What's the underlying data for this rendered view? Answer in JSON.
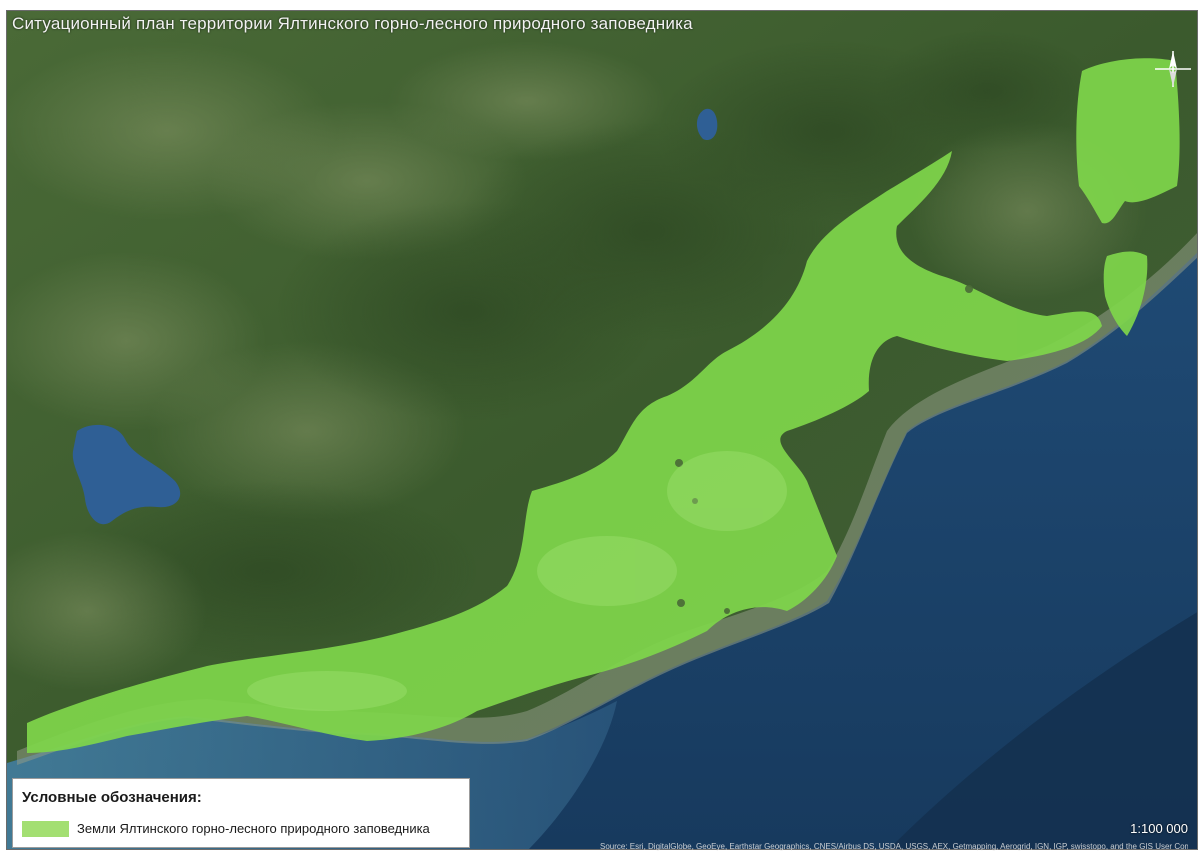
{
  "map": {
    "title": "Ситуационный план территории Ялтинского горно-лесного природного заповедника",
    "basemap": "satellite-imagery",
    "scale": "1:100 000",
    "credits": "Source: Esri, DigitalGlobe, GeoEye, Earthstar Geographics, CNES/Airbus DS, USDA, USGS, AEX, Getmapping, Aerogrid, IGN, IGP, swisstopo, and the GIS User Community"
  },
  "legend": {
    "title": "Условные обозначения:",
    "items": [
      {
        "label": "Земли Ялтинского горно-лесного природного заповедника",
        "color": "#a3df72"
      }
    ]
  },
  "colors": {
    "reserve_fill": "#7fd64b",
    "sea": "#1d3f66",
    "sea_shallow": "#3a6f8e",
    "forest": "#3c5a2c",
    "lake": "#2f5f95"
  },
  "icons": {
    "north_arrow": "north-arrow-icon"
  }
}
